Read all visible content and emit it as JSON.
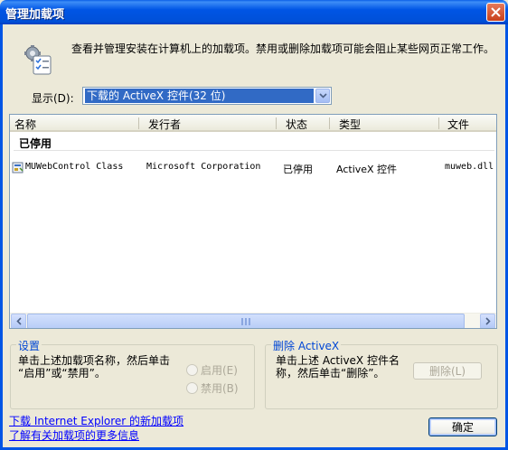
{
  "window": {
    "title": "管理加载项"
  },
  "intro": {
    "text": "查看并管理安装在计算机上的加载项。禁用或删除加载项可能会阻止某些网页正常工作。"
  },
  "show": {
    "label": "显示(D):",
    "value": "下载的 ActiveX 控件(32 位)"
  },
  "list": {
    "columns": [
      "名称",
      "发行者",
      "状态",
      "类型",
      "文件"
    ],
    "group": "已停用",
    "rows": [
      {
        "name": "MUWebControl Class",
        "publisher": "Microsoft Corporation",
        "status": "已停用",
        "type": "ActiveX 控件",
        "file": "muweb.dll"
      }
    ]
  },
  "settings": {
    "title": "设置",
    "text1": "单击上述加载项名称，然后单击",
    "text2": "“启用”或“禁用”。",
    "enable": "启用(E)",
    "disable": "禁用(B)"
  },
  "delete_box": {
    "title": "删除 ActiveX",
    "text1": "单击上述 ActiveX 控件名",
    "text2": "称，然后单击“删除”。",
    "button": "删除(L)"
  },
  "links": {
    "download": "下载 Internet Explorer 的新加载项",
    "learn": "了解有关加载项的更多信息"
  },
  "ok_button": "确定",
  "colors": {
    "title_bar": "#0055e5",
    "selection": "#316ac5",
    "link": "#0000ff"
  }
}
